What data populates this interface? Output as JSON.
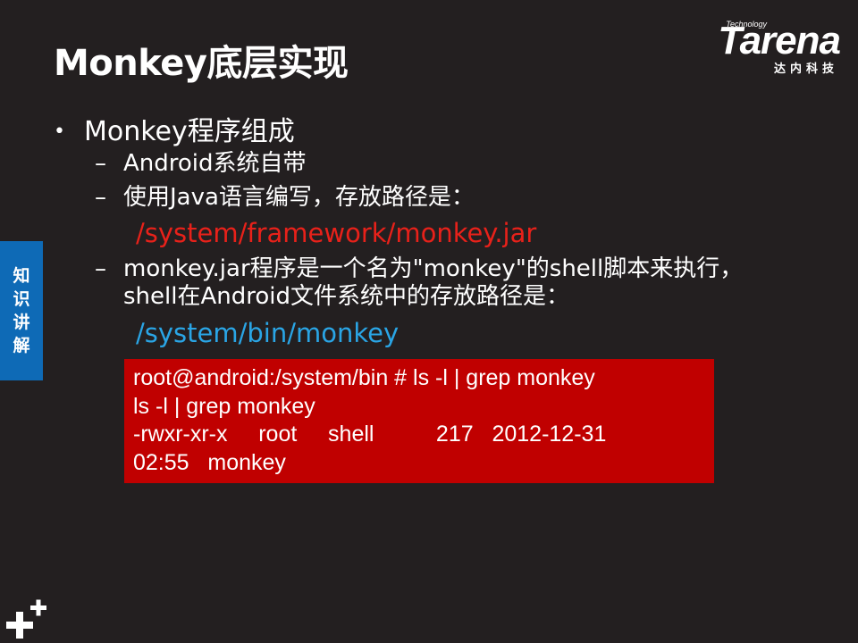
{
  "slide": {
    "title": "Monkey底层实现",
    "side_tab": [
      "知",
      "识",
      "讲",
      "解"
    ],
    "logo": {
      "brand": "Tarena",
      "tech": "Technology",
      "sub": "达内科技"
    },
    "bullet": {
      "dot": "•",
      "text": "Monkey程序组成"
    },
    "dash": "–",
    "items": [
      "Android系统自带",
      "使用Java语言编写，存放路径是："
    ],
    "path_jar": "/system/framework/monkey.jar",
    "shell_item": {
      "line1": "monkey.jar程序是一个名为\"monkey\"的shell脚本来执行，",
      "line2": "shell在Android文件系统中的存放路径是："
    },
    "path_bin": "/system/bin/monkey",
    "terminal": [
      "root@android:/system/bin # ls -l | grep monkey",
      "ls -l | grep monkey",
      "-rwxr-xr-x     root     shell          217   2012-12-31",
      "02:55   monkey"
    ]
  },
  "colors": {
    "background": "#231f20",
    "red_path": "#e8211a",
    "blue_path": "#2aa5e5",
    "terminal_bg": "#c00000",
    "side_tab_bg": "#0e6ab6"
  },
  "icons": {
    "corner": "plus-plus-icon"
  }
}
